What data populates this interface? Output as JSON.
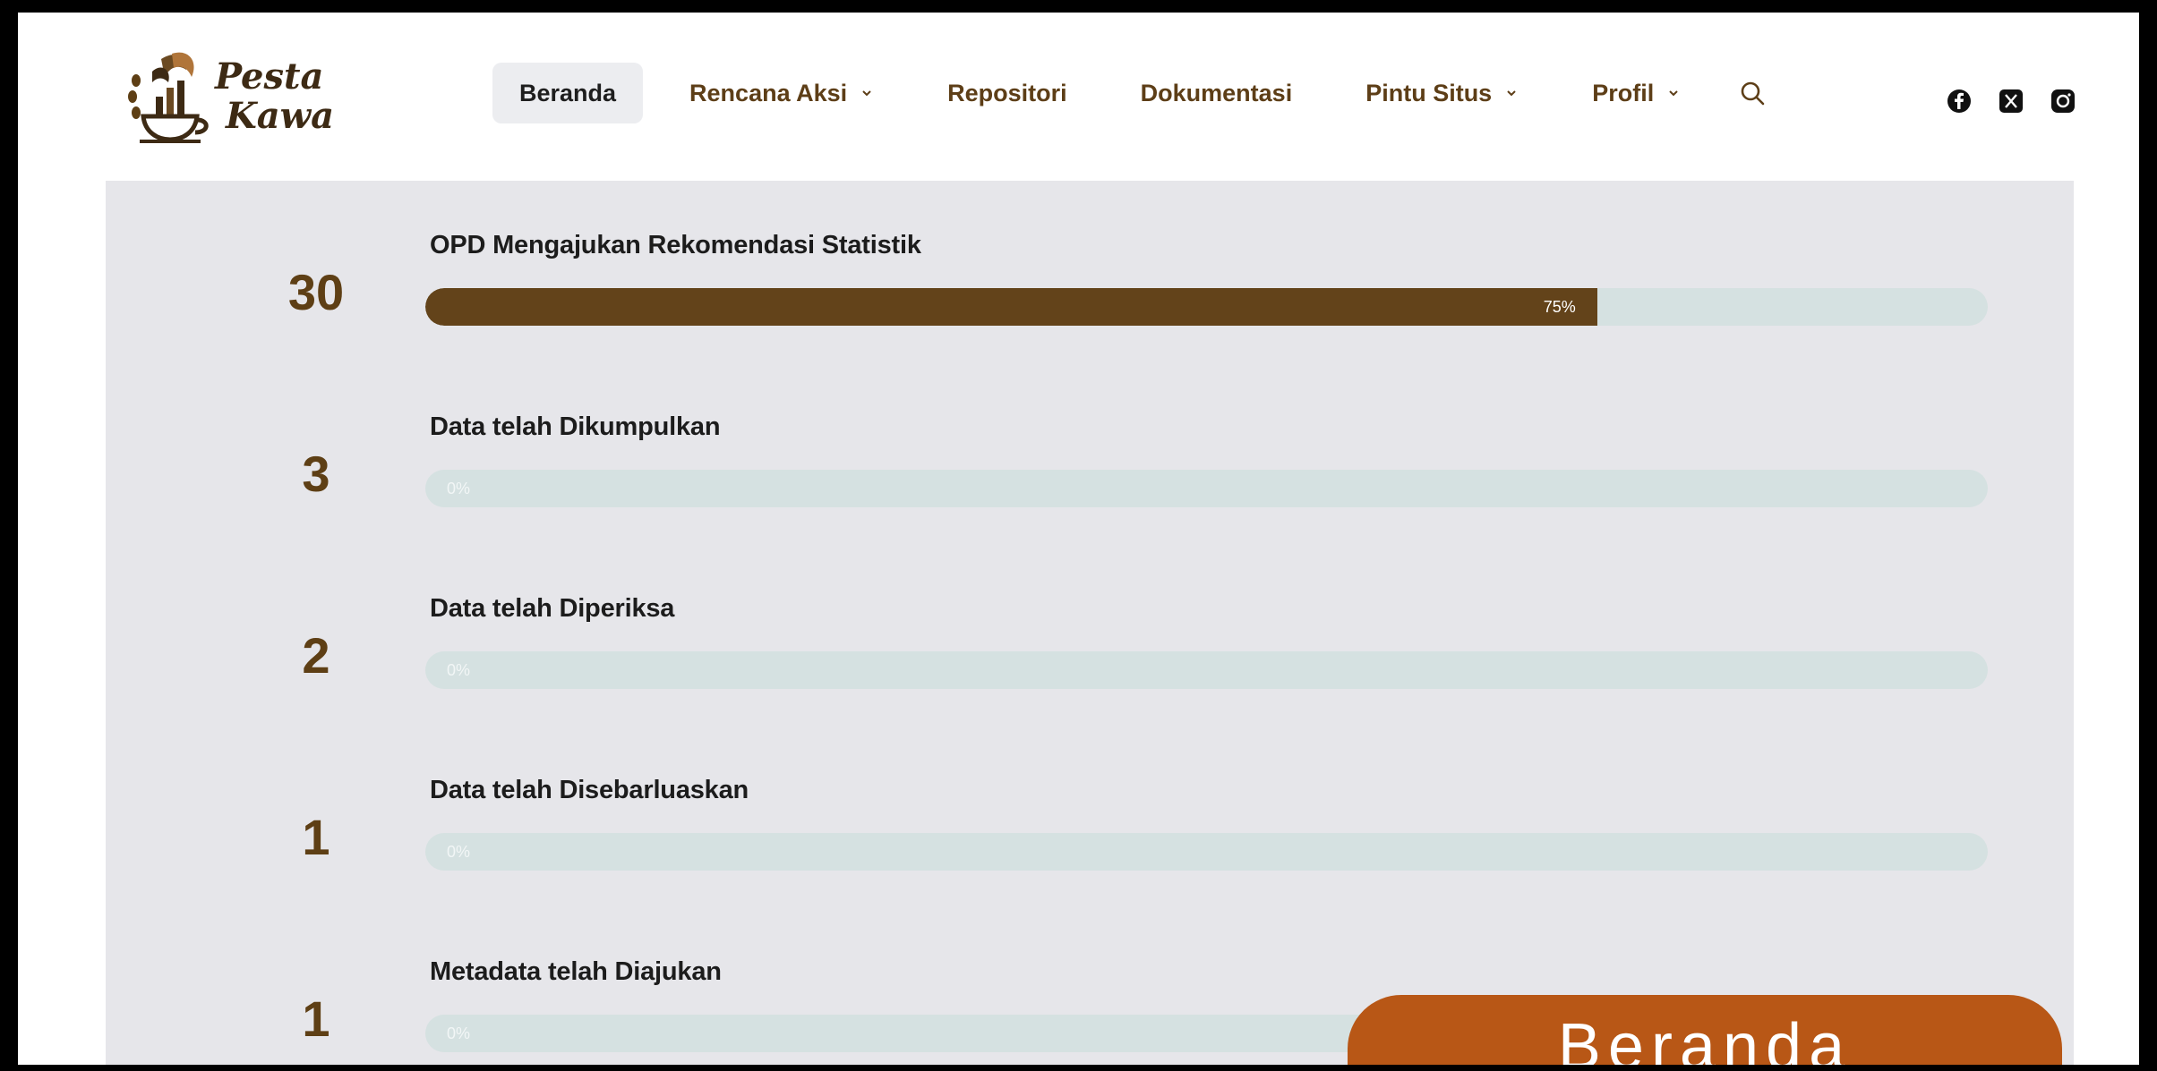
{
  "brand": {
    "name_line1": "Pesta",
    "name_line2": "Kawa",
    "color": "#5e3f15"
  },
  "nav": {
    "items": [
      {
        "label": "Beranda",
        "active": true,
        "dropdown": false
      },
      {
        "label": "Rencana Aksi",
        "active": false,
        "dropdown": true
      },
      {
        "label": "Repositori",
        "active": false,
        "dropdown": false
      },
      {
        "label": "Dokumentasi",
        "active": false,
        "dropdown": false
      },
      {
        "label": "Pintu Situs",
        "active": false,
        "dropdown": true
      },
      {
        "label": "Profil",
        "active": false,
        "dropdown": true
      }
    ],
    "search_icon": "search-icon"
  },
  "social": [
    "facebook-icon",
    "x-twitter-icon",
    "instagram-icon"
  ],
  "stats": [
    {
      "count": "30",
      "label": "OPD Mengajukan Rekomendasi Statistik",
      "percent": 75,
      "percent_label": "75%"
    },
    {
      "count": "3",
      "label": "Data telah Dikumpulkan",
      "percent": 0,
      "percent_label": "0%"
    },
    {
      "count": "2",
      "label": "Data telah Diperiksa",
      "percent": 0,
      "percent_label": "0%"
    },
    {
      "count": "1",
      "label": "Data telah Disebarluaskan",
      "percent": 0,
      "percent_label": "0%"
    },
    {
      "count": "1",
      "label": "Metadata telah Diajukan",
      "percent": 0,
      "percent_label": "0%"
    }
  ],
  "overlay_tag": "Beranda",
  "colors": {
    "accent_brown": "#63431a",
    "track": "#d5e1e1",
    "panel_bg": "#e6e6ea",
    "tag_orange": "#b85716"
  }
}
